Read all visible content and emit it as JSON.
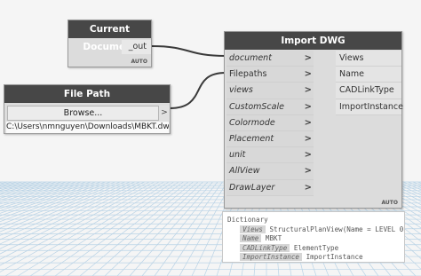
{
  "current_document": {
    "title": "Current Document",
    "output": "_out",
    "badge": "AUTO"
  },
  "file_path": {
    "title": "File Path",
    "browse_label": "Browse...",
    "output_arrow": ">",
    "value": "C:\\Users\\nmnguyen\\Downloads\\MBKT.dwg"
  },
  "import_dwg": {
    "title": "Import DWG",
    "badge": "AUTO",
    "inputs": [
      {
        "label": "document",
        "italic": true
      },
      {
        "label": "Filepaths",
        "italic": false
      },
      {
        "label": "views",
        "italic": true
      },
      {
        "label": "CustomScale",
        "italic": true
      },
      {
        "label": "Colormode",
        "italic": true
      },
      {
        "label": "Placement",
        "italic": true
      },
      {
        "label": "unit",
        "italic": true
      },
      {
        "label": "AllView",
        "italic": true
      },
      {
        "label": "DrawLayer",
        "italic": true
      }
    ],
    "input_chevron": ">",
    "outputs": [
      "Views",
      "Name",
      "CADLinkType",
      "ImportInstance"
    ]
  },
  "preview": {
    "title": "Dictionary",
    "rows": [
      {
        "key": "Views",
        "value": "StructuralPlanView(Name = LEVEL 0"
      },
      {
        "key": "Name",
        "value": "MBKT"
      },
      {
        "key": "CADLinkType",
        "value": "ElementType"
      },
      {
        "key": "ImportInstance",
        "value": "ImportInstance"
      }
    ]
  },
  "colors": {
    "header": "#474747",
    "node_body": "#dcdcdc",
    "wire": "#3a3a3a",
    "grid_line": "#b9d3e6",
    "background": "#f5f5f5"
  }
}
